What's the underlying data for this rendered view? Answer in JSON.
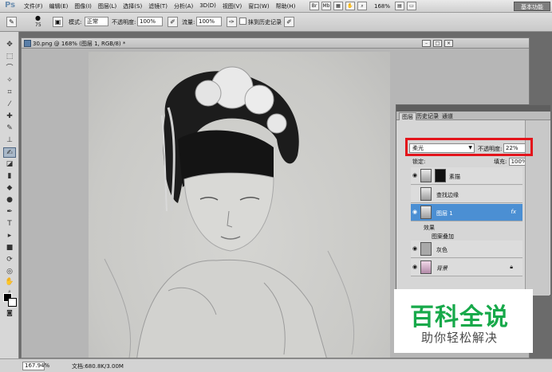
{
  "app": {
    "logo": "Ps"
  },
  "menu": [
    "文件(F)",
    "编辑(E)",
    "图像(I)",
    "图层(L)",
    "选择(S)",
    "滤镜(T)",
    "分析(A)",
    "3D(D)",
    "视图(V)",
    "窗口(W)",
    "帮助(H)"
  ],
  "menubar": {
    "zoom": "168%",
    "workspace": "基本功能",
    "icons": [
      "Br",
      "Mb"
    ]
  },
  "options": {
    "brush_size": "75",
    "mode_label": "模式:",
    "mode_value": "正常",
    "opacity_label": "不透明度:",
    "opacity_value": "100%",
    "flow_label": "流量:",
    "flow_value": "100%",
    "erase_history_label": "抹到历史记录"
  },
  "document": {
    "title": "30.png @ 168% (图层 1, RGB/8) *",
    "zoom": "167.94%",
    "info": "文档:680.8K/3.00M"
  },
  "layers_panel": {
    "tabs": [
      "图层",
      "历史记录",
      "通道"
    ],
    "blend_mode": "柔光",
    "opacity_label": "不透明度:",
    "opacity_value": "22%",
    "lock_label": "锁定:",
    "fill_label": "填充:",
    "fill_value": "100%",
    "layers": [
      {
        "name": "素描"
      },
      {
        "name": "查找边缘"
      },
      {
        "name": "图层 1",
        "fx": "fx"
      },
      {
        "name": "灰色"
      },
      {
        "name": "背景"
      }
    ],
    "effects_label": "效果",
    "pattern_overlay_label": "图案叠加"
  },
  "watermark": {
    "title": "百科全说",
    "subtitle": "助你轻松解决"
  }
}
